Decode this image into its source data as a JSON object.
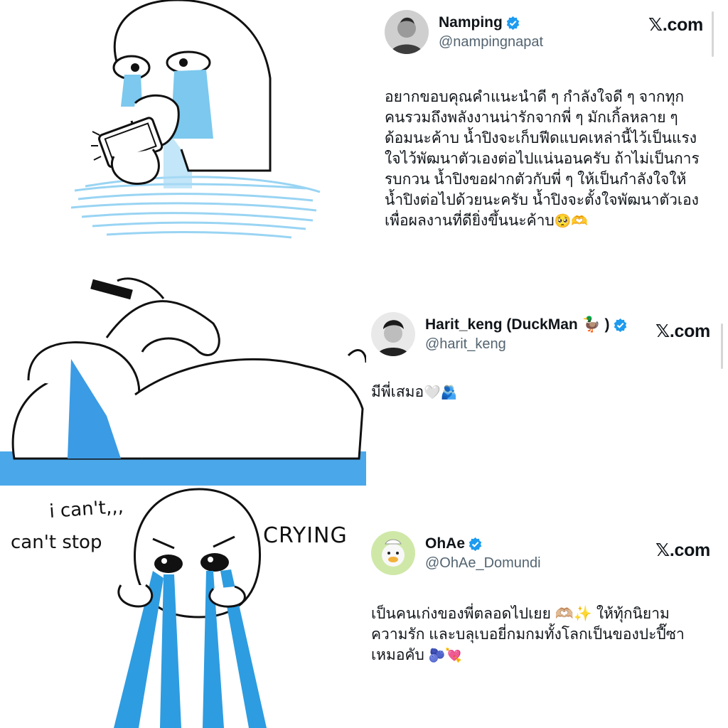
{
  "tweets": [
    {
      "name": "Namping",
      "handle": "@nampingnapat",
      "site": "𝕏.com",
      "text": "อยากขอบคุณคำแนะนำดี ๆ กำลังใจดี ๆ จากทุก\nคนรวมถึงพลังงานน่ารักจากพี่ ๆ มักเกิ้ลหลาย ๆ\nด้อมนะค้าบ น้ำปิงจะเก็บฟีดแบคเหล่านี้ไว้เป็นแรง\nใจไว้พัฒนาตัวเองต่อไปแน่นอนครับ ถ้าไม่เป็นการ\nรบกวน น้ำปิงขอฝากตัวกับพี่ ๆ ให้เป็นกำลังใจให้\nน้ำปิงต่อไปด้วยนะครับ น้ำปิงจะตั้งใจพัฒนาตัวเอง\nเพื่อผลงานที่ดียิ่งขึ้นนะค้าบ",
      "text_emoji": "🥺🫶",
      "avatar_icon": "person-avatar-icon"
    },
    {
      "name": "Harit_keng (DuckMan 🦆 )",
      "handle": "@harit_keng",
      "site": "𝕏.com",
      "text": "มีพี่เสมอ",
      "text_emoji": "🤍🫂",
      "avatar_icon": "person-avatar-icon"
    },
    {
      "name": "OhAe",
      "handle": "@OhAe_Domundi",
      "site": "𝕏.com",
      "text": "เป็นคนเก่งของพี่ตลอดไปเยย 🫶🏼✨ ให้ทุ้กนิยาม\nความรัก และบลุเบอยี่กมกมทั้งโลกเป็นของปะปี๊ซา\nเหมอคับ",
      "text_emoji": "🫐💘",
      "avatar_icon": "duck-avatar-icon"
    }
  ],
  "art": {
    "caption_line1": "i can't,,,",
    "caption_line2": "can't stop",
    "caption_line3": "CRYING"
  },
  "colors": {
    "tear_blue": "#7cc8ee",
    "tear_dark": "#2e9ce0",
    "verified": "#1d9bf0",
    "handle": "#536471"
  }
}
